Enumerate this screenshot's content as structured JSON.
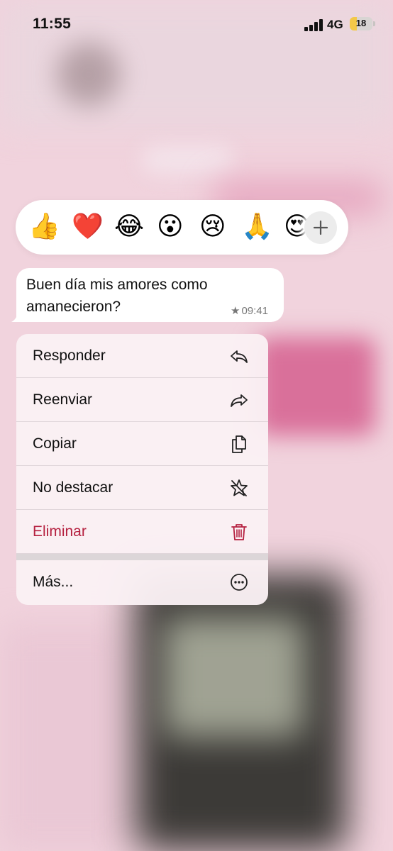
{
  "status_bar": {
    "time": "11:55",
    "network": "4G",
    "battery_level": "18",
    "signal_icon": "cellular-signal-icon"
  },
  "reactions": {
    "emojis": [
      "👍",
      "❤️",
      "😂",
      "😮",
      "😢",
      "🙏",
      "😍"
    ],
    "more_icon": "plus-icon"
  },
  "message": {
    "text": "Buen día mis amores como amanecieron?",
    "time": "09:41",
    "starred_icon": "star-icon"
  },
  "menu": {
    "items": [
      {
        "label": "Responder",
        "icon": "reply-icon"
      },
      {
        "label": "Reenviar",
        "icon": "forward-icon"
      },
      {
        "label": "Copiar",
        "icon": "copy-icon"
      },
      {
        "label": "No destacar",
        "icon": "unstar-icon"
      },
      {
        "label": "Eliminar",
        "icon": "trash-icon",
        "destructive": true
      },
      {
        "label": "Más...",
        "icon": "more-icon"
      }
    ],
    "destructive_color": "#b52140"
  }
}
